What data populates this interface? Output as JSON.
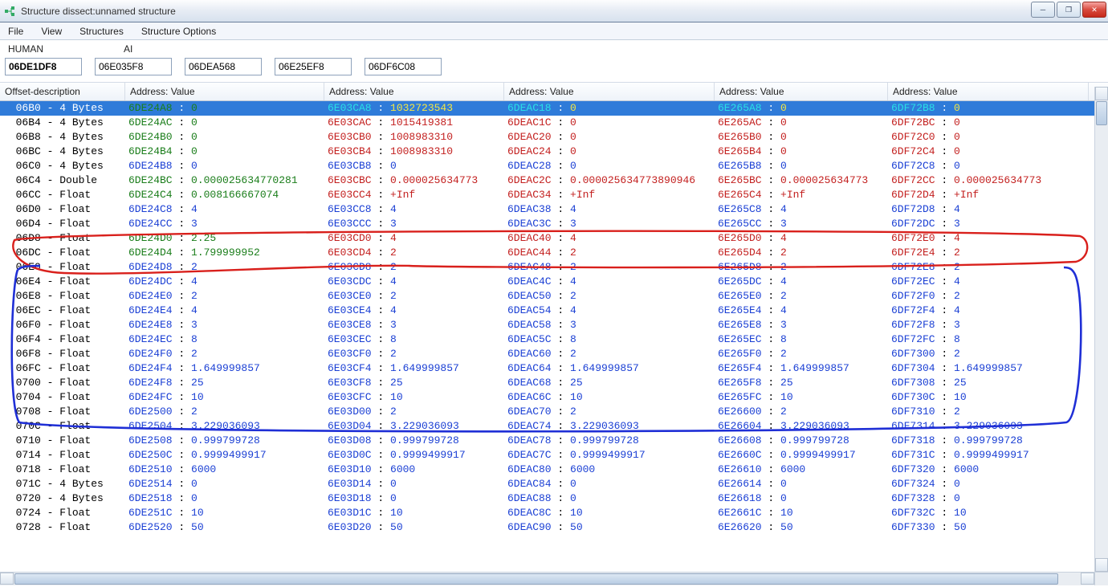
{
  "window": {
    "title": "Structure dissect:unnamed structure"
  },
  "menu": [
    "File",
    "View",
    "Structures",
    "Structure Options"
  ],
  "group_labels": [
    "HUMAN",
    "AI"
  ],
  "address_inputs": [
    "06DE1DF8",
    "06E035F8",
    "06DEA568",
    "06E25EF8",
    "06DF6C08"
  ],
  "columns": {
    "offset": "Offset-description",
    "av": "Address: Value"
  },
  "col_widths": {
    "offset": 156,
    "av": [
      248,
      224,
      262,
      216,
      250
    ]
  },
  "colors": {
    "normal_addr": "#1a3fd4",
    "normal_val": "#1a3fd4",
    "green": "#1a7d1a",
    "red": "#c3201f",
    "black": "#000000",
    "sel_cyan": "#29e0e6",
    "sel_yellow": "#f4e642",
    "sel_white": "#ffffff"
  },
  "rows": [
    {
      "offset": "06B0",
      "type": "4 Bytes",
      "sel": true,
      "cells": [
        {
          "a": "6DE24A8",
          "v": "0",
          "ac": "green",
          "vc": "green"
        },
        {
          "a": "6E03CA8",
          "v": "1032723543",
          "ac": "sel_cyan",
          "vc": "sel_yellow"
        },
        {
          "a": "6DEAC18",
          "v": "0",
          "ac": "sel_cyan",
          "vc": "sel_yellow"
        },
        {
          "a": "6E265A8",
          "v": "0",
          "ac": "sel_cyan",
          "vc": "sel_yellow"
        },
        {
          "a": "6DF72B8",
          "v": "0",
          "ac": "sel_cyan",
          "vc": "sel_yellow"
        }
      ]
    },
    {
      "offset": "06B4",
      "type": "4 Bytes",
      "cells": [
        {
          "a": "6DE24AC",
          "v": "0",
          "ac": "green",
          "vc": "green"
        },
        {
          "a": "6E03CAC",
          "v": "1015419381",
          "ac": "red",
          "vc": "red"
        },
        {
          "a": "6DEAC1C",
          "v": "0",
          "ac": "red",
          "vc": "red"
        },
        {
          "a": "6E265AC",
          "v": "0",
          "ac": "red",
          "vc": "red"
        },
        {
          "a": "6DF72BC",
          "v": "0",
          "ac": "red",
          "vc": "red"
        }
      ]
    },
    {
      "offset": "06B8",
      "type": "4 Bytes",
      "cells": [
        {
          "a": "6DE24B0",
          "v": "0",
          "ac": "green",
          "vc": "green"
        },
        {
          "a": "6E03CB0",
          "v": "1008983310",
          "ac": "red",
          "vc": "red"
        },
        {
          "a": "6DEAC20",
          "v": "0",
          "ac": "red",
          "vc": "red"
        },
        {
          "a": "6E265B0",
          "v": "0",
          "ac": "red",
          "vc": "red"
        },
        {
          "a": "6DF72C0",
          "v": "0",
          "ac": "red",
          "vc": "red"
        }
      ]
    },
    {
      "offset": "06BC",
      "type": "4 Bytes",
      "cells": [
        {
          "a": "6DE24B4",
          "v": "0",
          "ac": "green",
          "vc": "green"
        },
        {
          "a": "6E03CB4",
          "v": "1008983310",
          "ac": "red",
          "vc": "red"
        },
        {
          "a": "6DEAC24",
          "v": "0",
          "ac": "red",
          "vc": "red"
        },
        {
          "a": "6E265B4",
          "v": "0",
          "ac": "red",
          "vc": "red"
        },
        {
          "a": "6DF72C4",
          "v": "0",
          "ac": "red",
          "vc": "red"
        }
      ]
    },
    {
      "offset": "06C0",
      "type": "4 Bytes",
      "cells": [
        {
          "a": "6DE24B8",
          "v": "0",
          "ac": "normal_addr",
          "vc": "normal_val"
        },
        {
          "a": "6E03CB8",
          "v": "0",
          "ac": "normal_addr",
          "vc": "normal_val"
        },
        {
          "a": "6DEAC28",
          "v": "0",
          "ac": "normal_addr",
          "vc": "normal_val"
        },
        {
          "a": "6E265B8",
          "v": "0",
          "ac": "normal_addr",
          "vc": "normal_val"
        },
        {
          "a": "6DF72C8",
          "v": "0",
          "ac": "normal_addr",
          "vc": "normal_val"
        }
      ]
    },
    {
      "offset": "06C4",
      "type": "Double",
      "cells": [
        {
          "a": "6DE24BC",
          "v": "0.000025634770281",
          "ac": "green",
          "vc": "green"
        },
        {
          "a": "6E03CBC",
          "v": "0.000025634773",
          "ac": "red",
          "vc": "red"
        },
        {
          "a": "6DEAC2C",
          "v": "0.000025634773890946",
          "ac": "red",
          "vc": "red"
        },
        {
          "a": "6E265BC",
          "v": "0.000025634773",
          "ac": "red",
          "vc": "red"
        },
        {
          "a": "6DF72CC",
          "v": "0.000025634773",
          "ac": "red",
          "vc": "red"
        }
      ]
    },
    {
      "offset": "06CC",
      "type": "Float",
      "cells": [
        {
          "a": "6DE24C4",
          "v": "0.008166667074",
          "ac": "green",
          "vc": "green"
        },
        {
          "a": "6E03CC4",
          "v": "+Inf",
          "ac": "red",
          "vc": "red"
        },
        {
          "a": "6DEAC34",
          "v": "+Inf",
          "ac": "red",
          "vc": "red"
        },
        {
          "a": "6E265C4",
          "v": "+Inf",
          "ac": "red",
          "vc": "red"
        },
        {
          "a": "6DF72D4",
          "v": "+Inf",
          "ac": "red",
          "vc": "red"
        }
      ]
    },
    {
      "offset": "06D0",
      "type": "Float",
      "cells": [
        {
          "a": "6DE24C8",
          "v": "4"
        },
        {
          "a": "6E03CC8",
          "v": "4"
        },
        {
          "a": "6DEAC38",
          "v": "4"
        },
        {
          "a": "6E265C8",
          "v": "4"
        },
        {
          "a": "6DF72D8",
          "v": "4"
        }
      ]
    },
    {
      "offset": "06D4",
      "type": "Float",
      "cells": [
        {
          "a": "6DE24CC",
          "v": "3"
        },
        {
          "a": "6E03CCC",
          "v": "3"
        },
        {
          "a": "6DEAC3C",
          "v": "3"
        },
        {
          "a": "6E265CC",
          "v": "3"
        },
        {
          "a": "6DF72DC",
          "v": "3"
        }
      ]
    },
    {
      "offset": "06D8",
      "type": "Float",
      "cells": [
        {
          "a": "6DE24D0",
          "v": "2.25",
          "ac": "green",
          "vc": "green"
        },
        {
          "a": "6E03CD0",
          "v": "4",
          "ac": "red",
          "vc": "red"
        },
        {
          "a": "6DEAC40",
          "v": "4",
          "ac": "red",
          "vc": "red"
        },
        {
          "a": "6E265D0",
          "v": "4",
          "ac": "red",
          "vc": "red"
        },
        {
          "a": "6DF72E0",
          "v": "4",
          "ac": "red",
          "vc": "red"
        }
      ]
    },
    {
      "offset": "06DC",
      "type": "Float",
      "cells": [
        {
          "a": "6DE24D4",
          "v": "1.799999952",
          "ac": "green",
          "vc": "green"
        },
        {
          "a": "6E03CD4",
          "v": "2",
          "ac": "red",
          "vc": "red"
        },
        {
          "a": "6DEAC44",
          "v": "2",
          "ac": "red",
          "vc": "red"
        },
        {
          "a": "6E265D4",
          "v": "2",
          "ac": "red",
          "vc": "red"
        },
        {
          "a": "6DF72E4",
          "v": "2",
          "ac": "red",
          "vc": "red"
        }
      ]
    },
    {
      "offset": "06E0",
      "type": "Float",
      "cells": [
        {
          "a": "6DE24D8",
          "v": "2"
        },
        {
          "a": "6E03CD8",
          "v": "2"
        },
        {
          "a": "6DEAC48",
          "v": "2"
        },
        {
          "a": "6E265D8",
          "v": "2"
        },
        {
          "a": "6DF72E8",
          "v": "2"
        }
      ]
    },
    {
      "offset": "06E4",
      "type": "Float",
      "cells": [
        {
          "a": "6DE24DC",
          "v": "4"
        },
        {
          "a": "6E03CDC",
          "v": "4"
        },
        {
          "a": "6DEAC4C",
          "v": "4"
        },
        {
          "a": "6E265DC",
          "v": "4"
        },
        {
          "a": "6DF72EC",
          "v": "4"
        }
      ]
    },
    {
      "offset": "06E8",
      "type": "Float",
      "cells": [
        {
          "a": "6DE24E0",
          "v": "2"
        },
        {
          "a": "6E03CE0",
          "v": "2"
        },
        {
          "a": "6DEAC50",
          "v": "2"
        },
        {
          "a": "6E265E0",
          "v": "2"
        },
        {
          "a": "6DF72F0",
          "v": "2"
        }
      ]
    },
    {
      "offset": "06EC",
      "type": "Float",
      "cells": [
        {
          "a": "6DE24E4",
          "v": "4"
        },
        {
          "a": "6E03CE4",
          "v": "4"
        },
        {
          "a": "6DEAC54",
          "v": "4"
        },
        {
          "a": "6E265E4",
          "v": "4"
        },
        {
          "a": "6DF72F4",
          "v": "4"
        }
      ]
    },
    {
      "offset": "06F0",
      "type": "Float",
      "cells": [
        {
          "a": "6DE24E8",
          "v": "3"
        },
        {
          "a": "6E03CE8",
          "v": "3"
        },
        {
          "a": "6DEAC58",
          "v": "3"
        },
        {
          "a": "6E265E8",
          "v": "3"
        },
        {
          "a": "6DF72F8",
          "v": "3"
        }
      ]
    },
    {
      "offset": "06F4",
      "type": "Float",
      "cells": [
        {
          "a": "6DE24EC",
          "v": "8"
        },
        {
          "a": "6E03CEC",
          "v": "8"
        },
        {
          "a": "6DEAC5C",
          "v": "8"
        },
        {
          "a": "6E265EC",
          "v": "8"
        },
        {
          "a": "6DF72FC",
          "v": "8"
        }
      ]
    },
    {
      "offset": "06F8",
      "type": "Float",
      "cells": [
        {
          "a": "6DE24F0",
          "v": "2"
        },
        {
          "a": "6E03CF0",
          "v": "2"
        },
        {
          "a": "6DEAC60",
          "v": "2"
        },
        {
          "a": "6E265F0",
          "v": "2"
        },
        {
          "a": "6DF7300",
          "v": "2"
        }
      ]
    },
    {
      "offset": "06FC",
      "type": "Float",
      "cells": [
        {
          "a": "6DE24F4",
          "v": "1.649999857"
        },
        {
          "a": "6E03CF4",
          "v": "1.649999857"
        },
        {
          "a": "6DEAC64",
          "v": "1.649999857"
        },
        {
          "a": "6E265F4",
          "v": "1.649999857"
        },
        {
          "a": "6DF7304",
          "v": "1.649999857"
        }
      ]
    },
    {
      "offset": "0700",
      "type": "Float",
      "cells": [
        {
          "a": "6DE24F8",
          "v": "25"
        },
        {
          "a": "6E03CF8",
          "v": "25"
        },
        {
          "a": "6DEAC68",
          "v": "25"
        },
        {
          "a": "6E265F8",
          "v": "25"
        },
        {
          "a": "6DF7308",
          "v": "25"
        }
      ]
    },
    {
      "offset": "0704",
      "type": "Float",
      "cells": [
        {
          "a": "6DE24FC",
          "v": "10"
        },
        {
          "a": "6E03CFC",
          "v": "10"
        },
        {
          "a": "6DEAC6C",
          "v": "10"
        },
        {
          "a": "6E265FC",
          "v": "10"
        },
        {
          "a": "6DF730C",
          "v": "10"
        }
      ]
    },
    {
      "offset": "0708",
      "type": "Float",
      "cells": [
        {
          "a": "6DE2500",
          "v": "2"
        },
        {
          "a": "6E03D00",
          "v": "2"
        },
        {
          "a": "6DEAC70",
          "v": "2"
        },
        {
          "a": "6E26600",
          "v": "2"
        },
        {
          "a": "6DF7310",
          "v": "2"
        }
      ]
    },
    {
      "offset": "070C",
      "type": "Float",
      "cells": [
        {
          "a": "6DE2504",
          "v": "3.229036093"
        },
        {
          "a": "6E03D04",
          "v": "3.229036093"
        },
        {
          "a": "6DEAC74",
          "v": "3.229036093"
        },
        {
          "a": "6E26604",
          "v": "3.229036093"
        },
        {
          "a": "6DF7314",
          "v": "3.229036093"
        }
      ]
    },
    {
      "offset": "0710",
      "type": "Float",
      "cells": [
        {
          "a": "6DE2508",
          "v": "0.999799728"
        },
        {
          "a": "6E03D08",
          "v": "0.999799728"
        },
        {
          "a": "6DEAC78",
          "v": "0.999799728"
        },
        {
          "a": "6E26608",
          "v": "0.999799728"
        },
        {
          "a": "6DF7318",
          "v": "0.999799728"
        }
      ]
    },
    {
      "offset": "0714",
      "type": "Float",
      "cells": [
        {
          "a": "6DE250C",
          "v": "0.9999499917"
        },
        {
          "a": "6E03D0C",
          "v": "0.9999499917"
        },
        {
          "a": "6DEAC7C",
          "v": "0.9999499917"
        },
        {
          "a": "6E2660C",
          "v": "0.9999499917"
        },
        {
          "a": "6DF731C",
          "v": "0.9999499917"
        }
      ]
    },
    {
      "offset": "0718",
      "type": "Float",
      "cells": [
        {
          "a": "6DE2510",
          "v": "6000"
        },
        {
          "a": "6E03D10",
          "v": "6000"
        },
        {
          "a": "6DEAC80",
          "v": "6000"
        },
        {
          "a": "6E26610",
          "v": "6000"
        },
        {
          "a": "6DF7320",
          "v": "6000"
        }
      ]
    },
    {
      "offset": "071C",
      "type": "4 Bytes",
      "cells": [
        {
          "a": "6DE2514",
          "v": "0"
        },
        {
          "a": "6E03D14",
          "v": "0"
        },
        {
          "a": "6DEAC84",
          "v": "0"
        },
        {
          "a": "6E26614",
          "v": "0"
        },
        {
          "a": "6DF7324",
          "v": "0"
        }
      ]
    },
    {
      "offset": "0720",
      "type": "4 Bytes",
      "cells": [
        {
          "a": "6DE2518",
          "v": "0"
        },
        {
          "a": "6E03D18",
          "v": "0"
        },
        {
          "a": "6DEAC88",
          "v": "0"
        },
        {
          "a": "6E26618",
          "v": "0"
        },
        {
          "a": "6DF7328",
          "v": "0"
        }
      ]
    },
    {
      "offset": "0724",
      "type": "Float",
      "cells": [
        {
          "a": "6DE251C",
          "v": "10"
        },
        {
          "a": "6E03D1C",
          "v": "10"
        },
        {
          "a": "6DEAC8C",
          "v": "10"
        },
        {
          "a": "6E2661C",
          "v": "10"
        },
        {
          "a": "6DF732C",
          "v": "10"
        }
      ]
    },
    {
      "offset": "0728",
      "type": "Float",
      "cells": [
        {
          "a": "6DE2520",
          "v": "50"
        },
        {
          "a": "6E03D20",
          "v": "50"
        },
        {
          "a": "6DEAC90",
          "v": "50"
        },
        {
          "a": "6E26620",
          "v": "50"
        },
        {
          "a": "6DF7330",
          "v": "50"
        }
      ]
    }
  ]
}
